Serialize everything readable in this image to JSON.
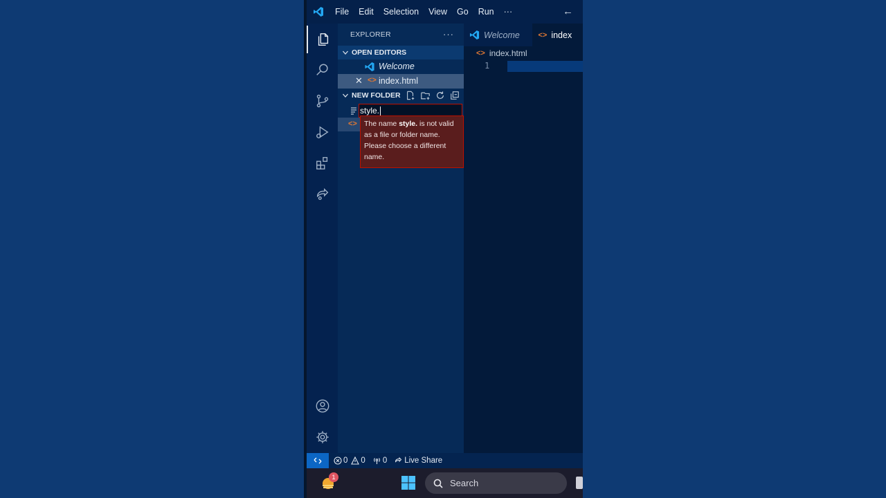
{
  "titlebar": {
    "menu": [
      "File",
      "Edit",
      "Selection",
      "View",
      "Go",
      "Run"
    ],
    "more": "···",
    "back": "←"
  },
  "sidebar": {
    "title": "EXPLORER",
    "more": "···",
    "open_editors": {
      "label": "OPEN EDITORS",
      "items": [
        {
          "label": "Welcome",
          "icon": "vscode-icon",
          "italic": true
        },
        {
          "label": "index.html",
          "icon": "html-file-icon",
          "selected": true,
          "close": "✕"
        }
      ]
    },
    "folder": {
      "label": "NEW FOLDER"
    },
    "rename_input": {
      "value": "style."
    },
    "error": {
      "prefix": "The name ",
      "name": "style.",
      "suffix": " is not valid as a file or folder name. Please choose a different name."
    }
  },
  "tabs": [
    {
      "label": "Welcome",
      "active": false
    },
    {
      "label": "index",
      "active": true
    }
  ],
  "breadcrumb": "index.html",
  "editor": {
    "line_number": "1"
  },
  "statusbar": {
    "errors": "0",
    "warnings": "0",
    "ports": "0",
    "live_share": "Live Share"
  },
  "taskbar": {
    "badge": "1",
    "search_label": "Search"
  },
  "colors": {
    "background": "#0e3a73",
    "error_border": "#be1100",
    "error_bg": "#5a1d1d",
    "accent": "#0c66c4"
  }
}
